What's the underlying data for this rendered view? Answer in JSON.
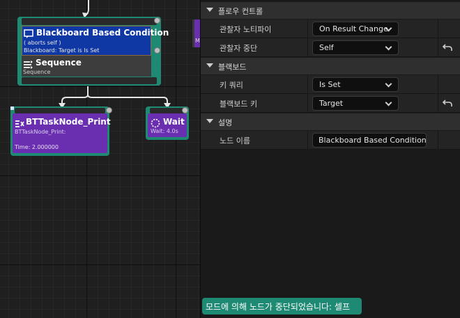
{
  "graph": {
    "composite": {
      "decorator_title": "Blackboard Based Condition",
      "decorator_aborts": "( aborts self )",
      "decorator_desc": "Blackboard: Target is Is Set",
      "sequence_title": "Sequence",
      "sequence_sub": "Sequence"
    },
    "task_print": {
      "title": "BTTaskNode_Print",
      "subtitle": "BTTaskNode_Print:",
      "time": "Time: 2.000000"
    },
    "task_wait": {
      "title": "Wait",
      "subtitle": "Wait: 4.0s"
    },
    "partial_node_letter": "M",
    "colors": {
      "node_frame": "#1e8a74",
      "decorator": "#1038a5",
      "task": "#6a2fb0",
      "composite_body": "#3d3d3d"
    }
  },
  "details": {
    "categories": [
      {
        "label": "플로우 컨트롤"
      },
      {
        "label": "블랙보드"
      },
      {
        "label": "설명"
      }
    ],
    "flow_control": {
      "observer_notify_label": "관찰자 노티파이",
      "observer_notify_value": "On Result Change",
      "observer_abort_label": "관찰자 중단",
      "observer_abort_value": "Self"
    },
    "blackboard": {
      "key_query_label": "키 쿼리",
      "key_query_value": "Is Set",
      "blackboard_key_label": "블랙보드 키",
      "blackboard_key_value": "Target"
    },
    "description": {
      "node_name_label": "노드 이름",
      "node_name_value": "Blackboard Based Condition"
    }
  },
  "status_message": "모드에 의해 노드가 중단되었습니다: 셀프",
  "icons": [
    "comment-icon",
    "sequence-icon",
    "task-icon",
    "wait-icon",
    "collapse-arrow-icon",
    "chevron-down-icon",
    "reset-arrow-icon"
  ]
}
